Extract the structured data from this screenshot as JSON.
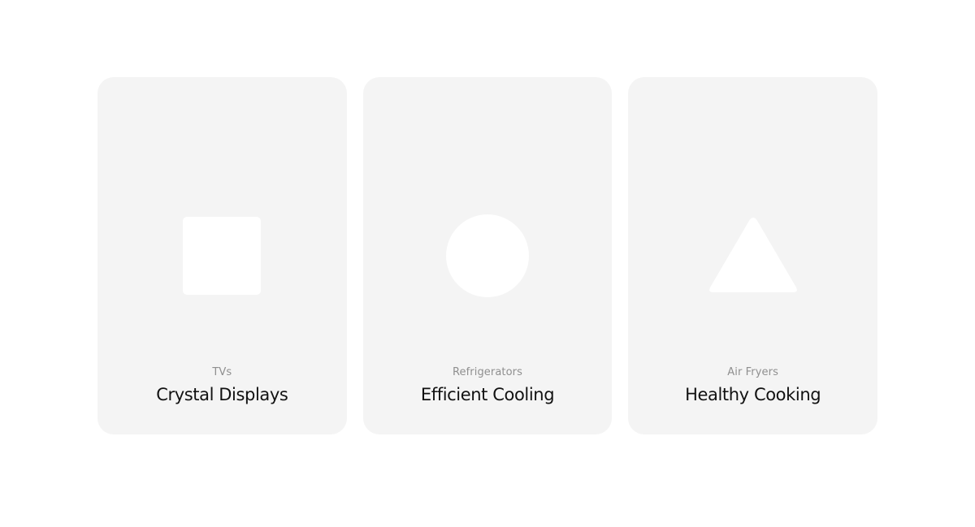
{
  "cards": [
    {
      "category": "TVs",
      "title": "Crystal Displays",
      "icon": "square-icon"
    },
    {
      "category": "Refrigerators",
      "title": "Efficient Cooling",
      "icon": "circle-icon"
    },
    {
      "category": "Air Fryers",
      "title": "Healthy Cooking",
      "icon": "triangle-icon"
    }
  ],
  "colors": {
    "page_background": "#ffffff",
    "card_background": "#f4f4f4",
    "shape_fill": "#ffffff",
    "category_text": "#8f8f8f",
    "title_text": "#111111"
  }
}
